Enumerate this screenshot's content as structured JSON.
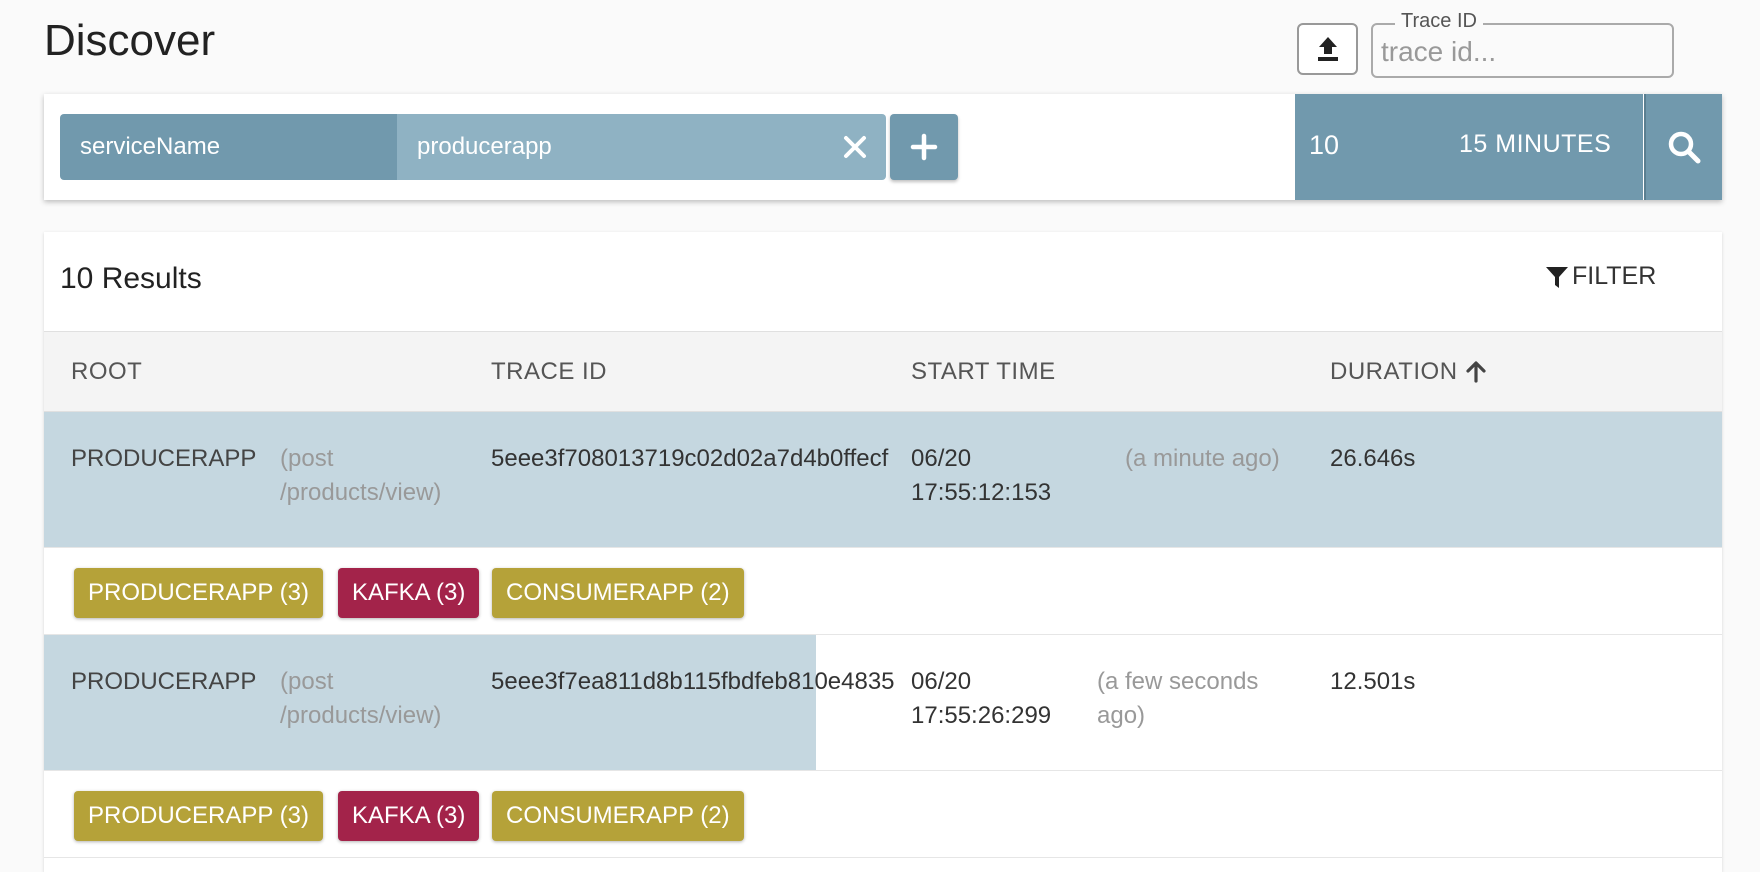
{
  "page": {
    "title": "Discover"
  },
  "header": {
    "upload_icon": "upload-icon",
    "trace_id_label": "Trace ID",
    "trace_id_placeholder": "trace id..."
  },
  "search": {
    "criteria_key": "serviceName",
    "criteria_value": "producerapp",
    "close_icon": "close-icon",
    "add_icon": "plus-icon",
    "limit": "10",
    "lookback": "15 MINUTES",
    "search_icon": "search-icon",
    "accent_color": "#7199ad"
  },
  "results": {
    "count_label": "10 Results",
    "filter_label": "FILTER",
    "filter_icon": "filter-icon",
    "columns": {
      "root": "ROOT",
      "trace_id": "TRACE ID",
      "start_time": "START TIME",
      "duration": "DURATION"
    },
    "sort_icon": "arrow-up-icon",
    "rows": [
      {
        "root_service": "PRODUCERAPP",
        "root_operation": "(post /products/view)",
        "trace_id": "5eee3f708013719c02d02a7d4b0ffecf",
        "start_date": "06/20 17:55:12:153",
        "start_relative": "(a minute ago)",
        "duration": "26.646s",
        "duration_fraction": 1.0,
        "tags": [
          {
            "label": "PRODUCERAPP (3)",
            "color": "#b5a239"
          },
          {
            "label": "KAFKA (3)",
            "color": "#a3234a"
          },
          {
            "label": "CONSUMERAPP (2)",
            "color": "#b5a239"
          }
        ]
      },
      {
        "root_service": "PRODUCERAPP",
        "root_operation": "(post /products/view)",
        "trace_id": "5eee3f7ea811d8b115fbdfeb810e4835",
        "start_date": "06/20 17:55:26:299",
        "start_relative": "(a few seconds ago)",
        "duration": "12.501s",
        "duration_fraction": 0.46,
        "tags": [
          {
            "label": "PRODUCERAPP (3)",
            "color": "#b5a239"
          },
          {
            "label": "KAFKA (3)",
            "color": "#a3234a"
          },
          {
            "label": "CONSUMERAPP (2)",
            "color": "#b5a239"
          }
        ]
      }
    ]
  }
}
